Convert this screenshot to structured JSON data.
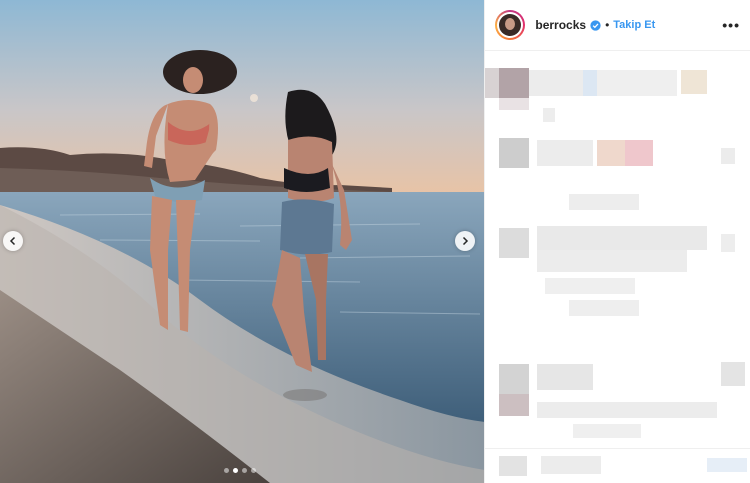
{
  "header": {
    "username": "berrocks",
    "separator": "•",
    "follow_label": "Takip Et",
    "more_label": "•••"
  },
  "icons": {
    "verified": "verified-badge-icon",
    "prev": "chevron-left-icon",
    "next": "chevron-right-icon",
    "more": "more-options-icon"
  },
  "carousel": {
    "count": 4,
    "active_index": 1
  },
  "colors": {
    "accent": "#3897f0",
    "username": "#262626",
    "border": "#efefef"
  }
}
